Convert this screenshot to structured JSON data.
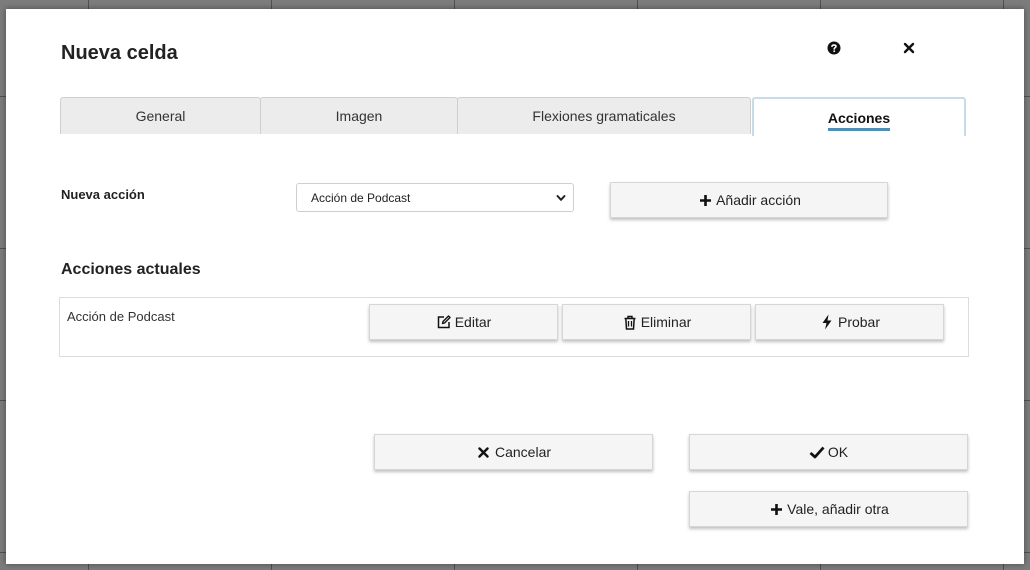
{
  "dialog": {
    "title": "Nueva celda",
    "help_icon": "question-circle-icon",
    "close_icon": "close-icon"
  },
  "tabs": [
    {
      "label": "General",
      "active": false
    },
    {
      "label": "Imagen",
      "active": false
    },
    {
      "label": "Flexiones gramaticales",
      "active": false
    },
    {
      "label": "Acciones",
      "active": true
    }
  ],
  "new_action": {
    "label": "Nueva acción",
    "selected": "Acción de Podcast",
    "add_button": "Añadir acción"
  },
  "current_actions": {
    "heading": "Acciones actuales",
    "items": [
      {
        "name": "Acción de Podcast",
        "edit_label": "Editar",
        "delete_label": "Eliminar",
        "test_label": "Probar"
      }
    ]
  },
  "footer": {
    "cancel_label": "Cancelar",
    "ok_label": "OK",
    "ok_add_label": "Vale, añadir otra"
  },
  "colors": {
    "accent": "#4f8fb5",
    "active_tab_border": "#c7dce8"
  }
}
